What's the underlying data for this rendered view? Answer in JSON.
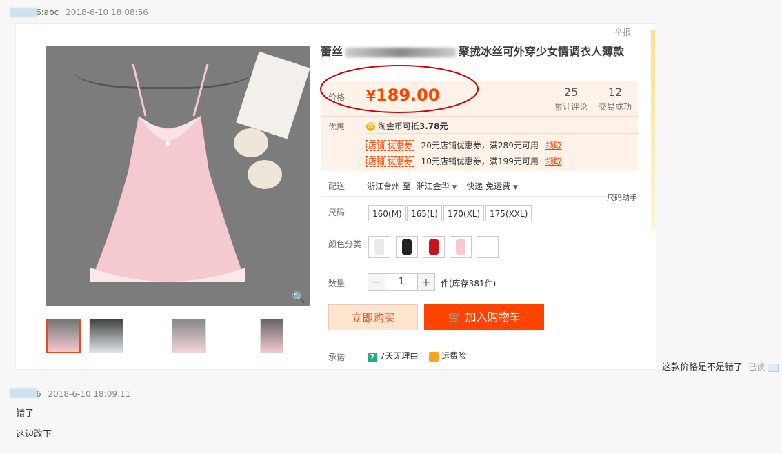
{
  "message1": {
    "sender": "6:abc",
    "timestamp": "2018-6-10 18:08:56"
  },
  "product": {
    "report_label": "举报",
    "title_prefix": "蕾丝",
    "title_suffix": "聚拢冰丝可外穿少女情调衣人薄款",
    "price_label": "价格",
    "currency": "¥",
    "price": "189.00",
    "reviews_count": "25",
    "reviews_label": "累计评论",
    "deals_count": "12",
    "deals_label": "交易成功",
    "promo_label": "优惠",
    "taojin_text": "淘金币可抵",
    "taojin_amount": "3.78元",
    "coupons": [
      {
        "tag": "店铺 优惠券",
        "text": "20元店铺优惠券，满289元可用",
        "action": "领取"
      },
      {
        "tag": "店铺 优惠券",
        "text": "10元店铺优惠券，满199元可用",
        "action": "领取"
      }
    ],
    "delivery_label": "配送",
    "delivery_from": "浙江台州 至",
    "delivery_to": "浙江金华",
    "delivery_method": "快递 免运费",
    "size_helper": "尺码助手",
    "size_label": "尺码",
    "sizes": [
      "160(M)",
      "165(L)",
      "170(XL)",
      "175(XXL)"
    ],
    "color_label": "颜色分类",
    "qty_label": "数量",
    "qty_minus": "−",
    "qty_value": "1",
    "qty_plus": "+",
    "stock_text": "件(库存381件)",
    "buy_now": "立即购买",
    "add_cart": "加入购物车",
    "promise_label": "承诺",
    "promise_7day": "7天无理由",
    "promise_freight": "运费险",
    "seven_badge": "7"
  },
  "chat_question": {
    "text": "这款价格是不是错了",
    "status": "已读"
  },
  "message2": {
    "sender": "6",
    "timestamp": "2018-6-10 18:09:11",
    "lines": [
      "错了",
      "这边改下"
    ]
  },
  "colors": {
    "accent": "#ff4400",
    "price_bg": "#fff2e8",
    "annotation": "#cc0000"
  }
}
